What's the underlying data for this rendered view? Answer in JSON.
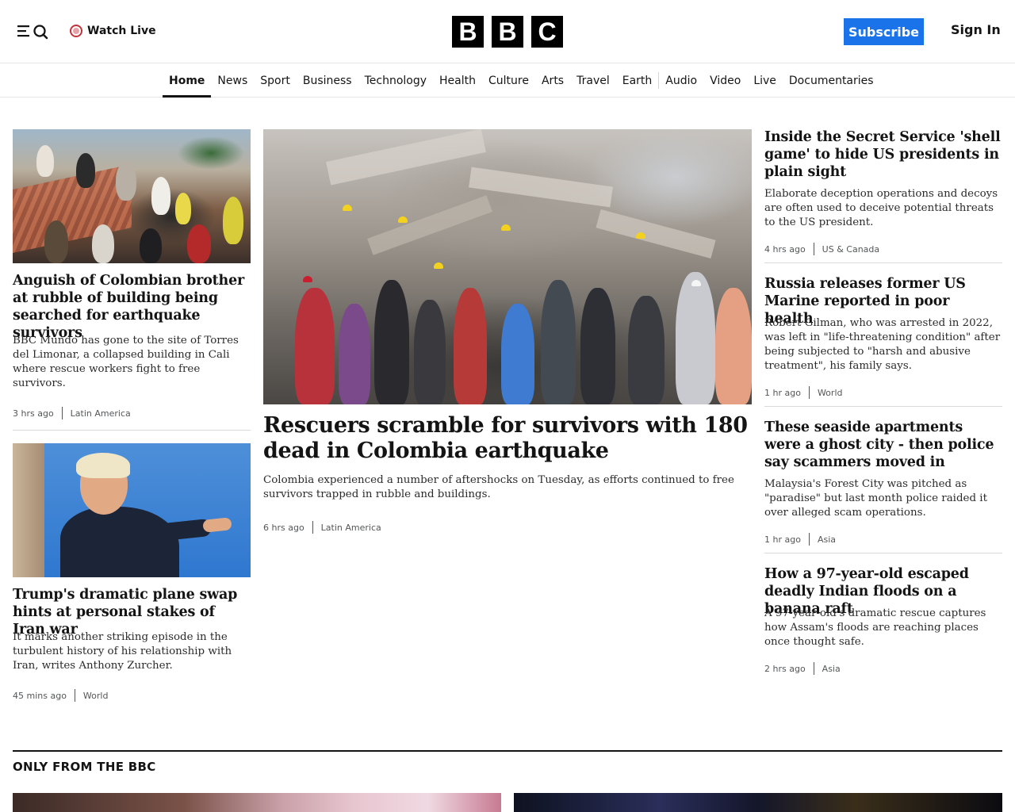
{
  "header": {
    "watch_live": "Watch Live",
    "logo_letters": [
      "B",
      "B",
      "C"
    ],
    "subscribe": "Subscribe",
    "sign_in": "Sign In",
    "accent": "#1a73e8",
    "live_color": "#c4333b"
  },
  "nav": {
    "items": [
      "Home",
      "News",
      "Sport",
      "Business",
      "Technology",
      "Health",
      "Culture",
      "Arts",
      "Travel",
      "Earth",
      "Audio",
      "Video",
      "Live",
      "Documentaries"
    ],
    "active": "Home"
  },
  "stories": {
    "left1": {
      "headline": "Anguish of Colombian brother at rubble of building being searched for earthquake survivors",
      "summary": "BBC Mundo has gone to the site of Torres del Limonar, a collapsed building in Cali where rescue workers fight to free survivors.",
      "time": "3 hrs ago",
      "category": "Latin America"
    },
    "left2": {
      "headline": "Trump's dramatic plane swap hints at personal stakes of Iran war",
      "summary": "It marks another striking episode in the turbulent history of his relationship with Iran, writes Anthony Zurcher.",
      "time": "45 mins ago",
      "category": "World"
    },
    "main": {
      "headline": "Rescuers scramble for survivors with 180 dead in Colombia earthquake",
      "summary": "Colombia experienced a number of aftershocks on Tuesday, as efforts continued to free survivors trapped in rubble and buildings.",
      "time": "6 hrs ago",
      "category": "Latin America"
    },
    "right1": {
      "headline": "Inside the Secret Service 'shell game' to hide US presidents in plain sight",
      "summary": "Elaborate deception operations and decoys are often used to deceive potential threats to the US president.",
      "time": "4 hrs ago",
      "category": "US & Canada"
    },
    "right2": {
      "headline": "Russia releases former US Marine reported in poor health",
      "summary": "Robert Gilman, who was arrested in 2022, was left in \"life-threatening condition\" after being subjected to \"harsh and abusive treatment\", his family says.",
      "time": "1 hr ago",
      "category": "World"
    },
    "right3": {
      "headline": "These seaside apartments were a ghost city - then police say scammers moved in",
      "summary": "Malaysia's Forest City was pitched as \"paradise\" but last month police raided it over alleged scam operations.",
      "time": "1 hr ago",
      "category": "Asia"
    },
    "right4": {
      "headline": "How a 97-year-old escaped deadly Indian floods on a banana raft",
      "summary": "A 97-year-old's dramatic rescue captures how Assam's floods are reaching places once thought safe.",
      "time": "2 hrs ago",
      "category": "Asia"
    }
  },
  "section": {
    "title": "ONLY FROM THE BBC"
  }
}
